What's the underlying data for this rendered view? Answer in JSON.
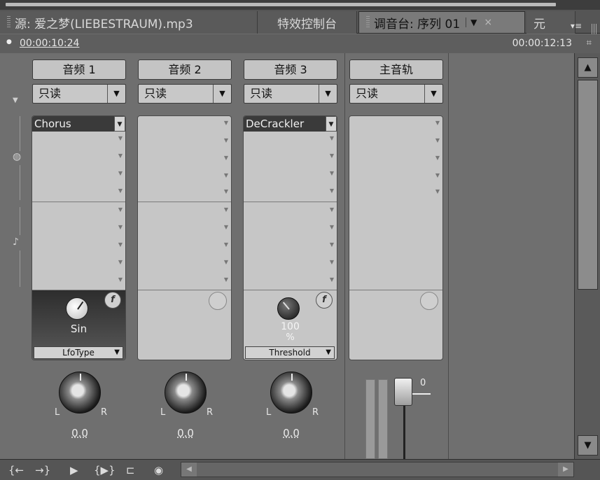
{
  "tabs": {
    "source": "源: 爱之梦(LIEBESTRAUM).mp3",
    "effects": "特效控制台",
    "mixer": "调音台: 序列 01",
    "more": "元",
    "close": "×",
    "menu": "▾≡"
  },
  "time": {
    "current": "00:00:10:24",
    "total": "00:00:12:13"
  },
  "channels": [
    {
      "name": "音频 1",
      "mode": "只读",
      "effect": "Chorus",
      "fx_value": "Sin",
      "fx_unit": "",
      "fx_param": "LfoType",
      "pan": "0.0"
    },
    {
      "name": "音频 2",
      "mode": "只读",
      "effect": "",
      "fx_value": "",
      "fx_unit": "",
      "fx_param": "",
      "pan": "0.0"
    },
    {
      "name": "音频 3",
      "mode": "只读",
      "effect": "DeCrackler",
      "fx_value": "100",
      "fx_unit": "%",
      "fx_param": "Threshold",
      "pan": "0.0"
    },
    {
      "name": "主音轨",
      "mode": "只读",
      "effect": "",
      "fx_value": "",
      "fx_unit": "",
      "fx_param": "",
      "pan": ""
    }
  ],
  "pan_labels": {
    "left": "L",
    "right": "R"
  },
  "master": {
    "fader_value": "0"
  },
  "icons": {
    "bypass": "fx-bypass-icon",
    "play": "play-icon",
    "record": "record-icon"
  }
}
